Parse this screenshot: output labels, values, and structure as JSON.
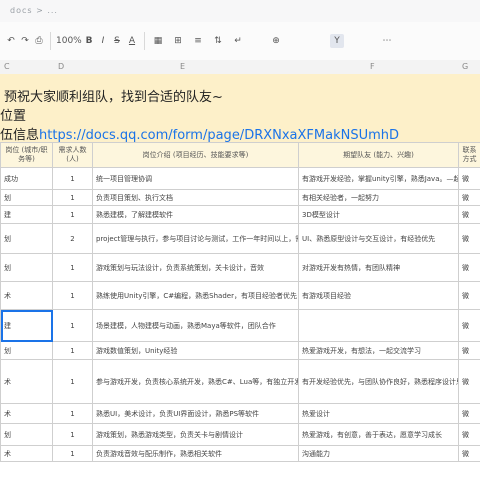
{
  "topbar": {
    "crumb": "docs > ..."
  },
  "toolbar": {
    "items": [
      "↶",
      "↷",
      "⎙",
      "100%",
      "B",
      "I",
      "S",
      "A",
      "▦",
      "⊞",
      "≡",
      "⇅",
      "↵",
      "⊕",
      "Y",
      "⋯"
    ]
  },
  "columns": [
    "C",
    "D",
    "E",
    "F",
    "G"
  ],
  "banner": {
    "line1": "预祝大家顺利组队，找到合适的队友~",
    "line2": "位置",
    "line3_prefix": "伍信息",
    "url": "https://docs.qq.com/form/page/DRXNxaXFMakNSUmhD"
  },
  "table": {
    "headers": [
      "岗位\n(城市/职务等)",
      "需求人数\n(人)",
      "岗位介绍\n(项目经历、技能要求等)",
      "期望队友\n(能力、兴趣)",
      "联系\n方式"
    ],
    "rows": [
      [
        "成功",
        "1",
        "统一项目管理协调",
        "有游戏开发经验，掌握unity引擎，熟悉Java。—起",
        "微"
      ],
      [
        "划",
        "1",
        "负责项目策划、执行文档",
        "有相关经验者，一起努力",
        "微"
      ],
      [
        "建",
        "1",
        "熟悉建模，了解建模软件",
        "3D模型设计",
        "微"
      ],
      [
        "划",
        "2",
        "project管理与执行，参与项目讨论与测试，工作一年时间以上，需要：UI/UX设计师",
        "UI、熟悉原型设计与交互设计，有经验优先",
        "微"
      ],
      [
        "划",
        "1",
        "游戏策划与玩法设计，负责系统策划，关卡设计，音效",
        "对游戏开发有热情，有团队精神",
        "微"
      ],
      [
        "术",
        "1",
        "熟练使用Unity引擎，C#编程，熟悉Shader，有项目经验者优先",
        "有游戏项目经验",
        "微"
      ],
      [
        "建",
        "1",
        "场景建模，人物建模与动画，熟悉Maya等软件，团队合作",
        "",
        "微"
      ],
      [
        "划",
        "1",
        "游戏数值策划，Unity经验",
        "热爱游戏开发，有想法，一起交流学习",
        "微"
      ],
      [
        "术",
        "1",
        "参与游戏开发，负责核心系统开发，熟悉C#、Lua等，有独立开发经验，可以在比赛中完成核心内容开发（负责技术方案设计）",
        "有开发经验优先，与团队协作良好，熟悉程序设计思路",
        "微"
      ],
      [
        "术",
        "1",
        "熟悉UI，美术设计，负责UI界面设计，熟悉PS等软件",
        "热爱设计",
        "微"
      ],
      [
        "划",
        "1",
        "游戏策划，熟悉游戏类型，负责关卡与剧情设计",
        "热爱游戏，有创意，善于表达，愿意学习成长",
        "微"
      ],
      [
        "术",
        "1",
        "负责游戏音效与配乐制作，熟悉相关软件",
        "沟通能力",
        "微"
      ]
    ]
  }
}
